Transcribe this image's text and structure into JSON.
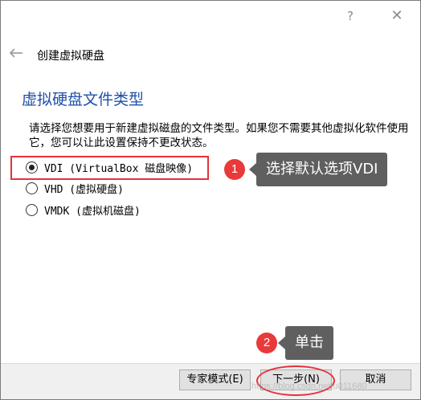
{
  "titlebar": {
    "help": "?",
    "close": "✕"
  },
  "wizard": {
    "title": "创建虚拟硬盘"
  },
  "section": {
    "heading": "虚拟硬盘文件类型",
    "description": "请选择您想要用于新建虚拟磁盘的文件类型。如果您不需要其他虚拟化软件使用它，您可以让此设置保持不更改状态。"
  },
  "options": [
    {
      "label": "VDI (VirtualBox 磁盘映像)",
      "checked": true
    },
    {
      "label": "VHD (虚拟硬盘)",
      "checked": false
    },
    {
      "label": "VMDK (虚拟机磁盘)",
      "checked": false
    }
  ],
  "annotations": [
    {
      "number": "1",
      "text": "选择默认选项VDI"
    },
    {
      "number": "2",
      "text": "单击"
    }
  ],
  "buttons": {
    "expert": "专家模式(E)",
    "next": "下一步(N)",
    "cancel": "取消"
  },
  "watermark": "https://blog.csdn.net/u011680",
  "colors": {
    "heading": "#1f4fa8",
    "annotation": "#e5323c",
    "callout": "#5f5f5f"
  }
}
